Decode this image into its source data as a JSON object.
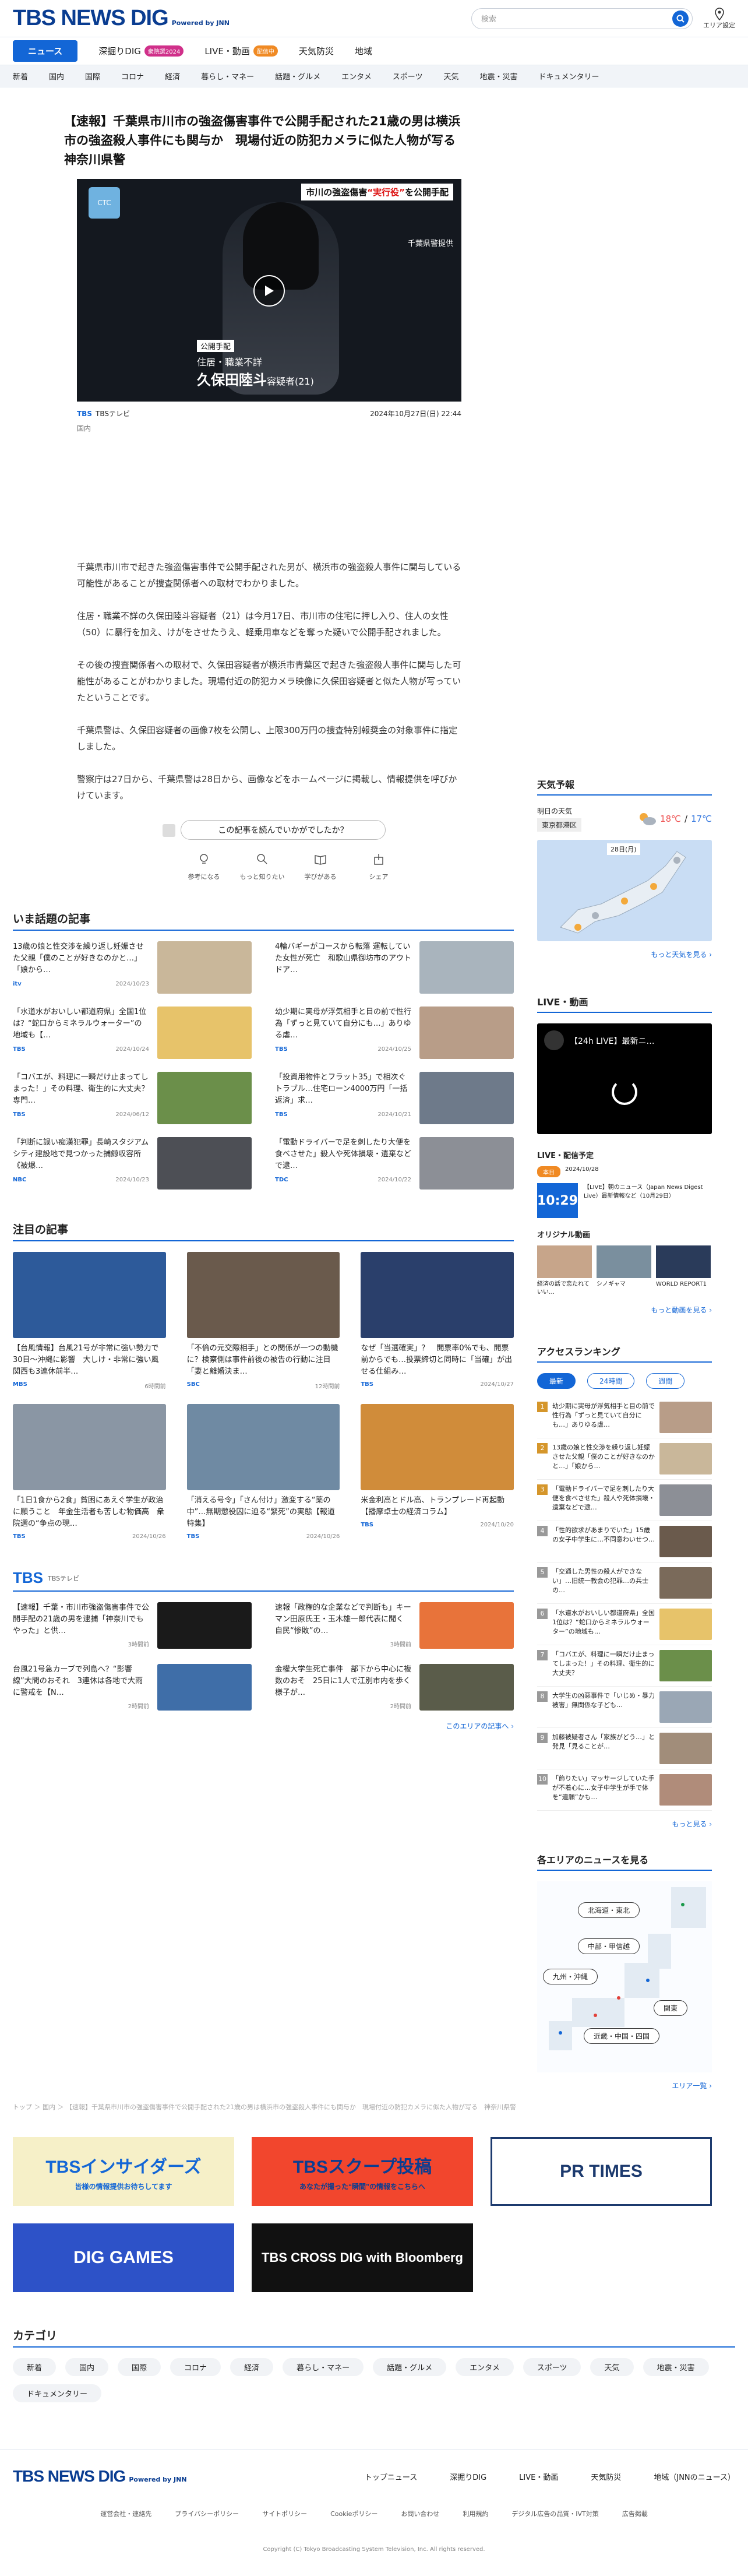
{
  "header": {
    "logo": "TBS NEWS DIG",
    "powered": "Powered by JNN",
    "search_placeholder": "検索",
    "area_label": "エリア設定"
  },
  "nav_main": [
    {
      "label": "ニュース",
      "active": true
    },
    {
      "label": "深掘りDIG",
      "badge": "衆院選2024"
    },
    {
      "label": "LIVE・動画",
      "badge": "配信中"
    },
    {
      "label": "天気防災"
    },
    {
      "label": "地域"
    }
  ],
  "nav_cats": [
    "新着",
    "国内",
    "国際",
    "コロナ",
    "経済",
    "暮らし・マネー",
    "話題・グルメ",
    "エンタメ",
    "スポーツ",
    "天気",
    "地震・災害",
    "ドキュメンタリー"
  ],
  "article": {
    "title": "【速報】千葉県市川市の強盗傷害事件で公開手配された21歳の男は横浜市の強盗殺人事件にも関与か　現場付近の防犯カメラに似た人物が写る　神奈川県警",
    "hero": {
      "caption_pre": "市川の強盗傷害",
      "caption_mid": "“実行役”",
      "caption_post": "を公開手配",
      "credit": "千葉県警提供",
      "tag": "公開手配",
      "line1": "住居・職業不詳",
      "name": "久保田陸斗",
      "suffix": "容疑者(21)"
    },
    "source": "TBSテレビ",
    "date": "2024年10月27日(日) 22:44",
    "category": "国内",
    "paragraphs": [
      "千葉県市川市で起きた強盗傷害事件で公開手配された男が、横浜市の強盗殺人事件に関与している可能性があることが捜査関係者への取材でわかりました。",
      "住居・職業不詳の久保田陸斗容疑者（21）は今月17日、市川市の住宅に押し入り、住人の女性（50）に暴行を加え、けがをさせたうえ、軽乗用車などを奪った疑いで公開手配されました。",
      "その後の捜査関係者への取材で、久保田容疑者が横浜市青葉区で起きた強盗殺人事件に関与した可能性があることがわかりました。現場付近の防犯カメラ映像に久保田容疑者と似た人物が写っていたということです。",
      "千葉県警は、久保田容疑者の画像7枚を公開し、上限300万円の捜査特別報奨金の対象事件に指定しました。",
      "警察庁は27日から、千葉県警は28日から、画像などをホームページに掲載し、情報提供を呼びかけています。"
    ],
    "feedback_question": "この記事を読んでいかがでしたか？",
    "feedback_options": [
      "参考になる",
      "もっと知りたい",
      "学びがある",
      "シェア"
    ]
  },
  "trending": {
    "title": "いま話題の記事",
    "items": [
      {
        "title": "13歳の娘と性交渉を繰り返し妊娠させた父親「僕のことが好きなのかと…」「娘から…",
        "source": "itv",
        "date": "2024/10/23",
        "color": "#c9b79a"
      },
      {
        "title": "4輪バギーがコースから転落 運転していた女性が死亡　和歌山県御坊市のアウトドア…",
        "source": "",
        "date": "",
        "color": "#a9b4bd"
      },
      {
        "title": "「水道水がおいしい都道府県」全国1位は？“蛇口からミネラルウォーター”の地域も【…",
        "source": "TBS",
        "date": "2024/10/24",
        "color": "#e7c36a"
      },
      {
        "title": "幼少期に実母が浮気相手と目の前で性行為「ずっと見ていて自分にも…」ありゆる虐…",
        "source": "TBS",
        "date": "2024/10/25",
        "color": "#b89d88"
      },
      {
        "title": "「コバエが、料理に一瞬だけ止まってしまった！」その料理、衛生的に大丈夫？専門…",
        "source": "TBS",
        "date": "2024/06/12",
        "color": "#6b8f4a"
      },
      {
        "title": "「投資用物件とフラット35」で相次ぐトラブル…住宅ローン4000万円「一括返済」求…",
        "source": "TBS",
        "date": "2024/10/21",
        "color": "#6e7a8a"
      },
      {
        "title": "「判断に誤い痴漢犯罪」長崎スタジアムシティ建設地で見つかった捕鯨収容所《被爆…",
        "source": "NBC",
        "date": "2024/10/23",
        "color": "#4d4f55"
      },
      {
        "title": "「電動ドライバーで足を刺したり大便を食べさせた」殺人や死体損壊・遺棄などで逮…",
        "source": "TDC",
        "date": "2024/10/22",
        "color": "#8c8f96"
      }
    ]
  },
  "featured": {
    "title": "注目の記事",
    "items": [
      {
        "title": "【台風情報】台風21号が非常に強い勢力で30日〜沖縄に影響　大しけ・非常に強い風　関西も3連休前半…",
        "source": "MBS",
        "date": "6時間前",
        "color": "#2d5a9a"
      },
      {
        "title": "「不倫の元交際相手」との関係が一つの動機に？検察側は事件前後の被告の行動に注目「妻と離婚決ま…",
        "source": "SBC",
        "date": "12時間前",
        "color": "#6a5a4c"
      },
      {
        "title": "なぜ「当選確実」？　開票率0%でも、開票前からでも…投票締切と同時に「当確」が出せる仕組み…",
        "source": "TBS",
        "date": "2024/10/27",
        "color": "#2a3f6b"
      },
      {
        "title": "「1日1食から2食」貧困にあえぐ学生が政治に願うこと　年金生活者も苦しむ物価高　衆院選の“争点の現…",
        "source": "TBS",
        "date": "2024/10/26",
        "color": "#8a96a4"
      },
      {
        "title": "「消える号令」「さん付け」激変する“薬の中”…無期懲役囚に迫る“緊死”の実態【報道特集】",
        "source": "TBS",
        "date": "2024/10/26",
        "color": "#6f8aa3"
      },
      {
        "title": "米金利高とドル高、トランプレード再起動【播摩卓士の経済コラム】",
        "source": "TBS",
        "date": "2024/10/20",
        "color": "#d08c3a"
      }
    ]
  },
  "tbs_section": {
    "logo": "TBS",
    "sub": "TBSテレビ",
    "items": [
      {
        "title": "【速報】千葉・市川市強盗傷害事件で公開手配の21歳の男を逮捕「神奈川でもやった」と供…",
        "date": "3時間前",
        "color": "#1a1a1a"
      },
      {
        "title": "速報「政権的な企業などで判断も」キーマン田原氏王・玉木雄一郎代表に聞く 自民“惨敗”の…",
        "date": "3時間前",
        "color": "#e8733a"
      },
      {
        "title": "台風21号急カーブで列島へ？“影響線”大間のおそれ　3連休は各地で大雨に警戒を【N…",
        "date": "2時間前",
        "color": "#3f6ea8"
      },
      {
        "title": "金權大学生死亡事件　部下から中心に複数のおそ　25日に1人で江別市内を歩く様子が…",
        "date": "2時間前",
        "color": "#5a5c4a"
      }
    ],
    "more": "このエリアの記事へ ›"
  },
  "breadcrumb": "トップ ＞ 国内 ＞ 【速報】千葉県市川市の強盗傷害事件で公開手配された21歳の男は横浜市の強盗殺人事件にも関与か　現場付近の防犯カメラに似た人物が写る　神奈川県警",
  "banners": [
    {
      "label": "TBSインサイダーズ",
      "sub": "皆様の情報提供お待ちしてます",
      "bg": "#f6f0c8",
      "fg": "#1366d6"
    },
    {
      "label": "TBSスクープ投稿",
      "sub": "あなたが撮った“瞬間”の情報をこちらへ",
      "bg": "#f2462d",
      "fg": "#0a3d91"
    },
    {
      "label": "PR TIMES",
      "sub": "",
      "bg": "#ffffff",
      "fg": "#1c3a6e"
    },
    {
      "label": "DIG GAMES",
      "sub": "",
      "bg": "#2d52c8",
      "fg": "#ffffff"
    },
    {
      "label": "TBS CROSS DIG with Bloomberg",
      "sub": "",
      "bg": "#111111",
      "fg": "#ffffff"
    }
  ],
  "categories_title": "カテゴリ",
  "category_chips": [
    "新着",
    "国内",
    "国際",
    "コロナ",
    "経済",
    "暮らし・マネー",
    "話題・グルメ",
    "エンタメ",
    "スポーツ",
    "天気",
    "地震・災害",
    "ドキュメンタリー"
  ],
  "footer": {
    "links": [
      "トップニュース",
      "深掘りDIG",
      "LIVE・動画",
      "天気防災",
      "地域（JNNのニュース）"
    ],
    "sub": [
      "運営会社・連絡先",
      "プライバシーポリシー",
      "サイトポリシー",
      "Cookieポリシー",
      "お問い合わせ",
      "利用規約",
      "デジタル広告の品質・IVT対策",
      "広告掲載"
    ],
    "copyright": "Copyright (C) Tokyo Broadcasting System Television, Inc. All rights reserved."
  },
  "side": {
    "weather_title": "天気予報",
    "weather_day": "明日の天気",
    "weather_city": "東京都港区",
    "temp_high": "18℃",
    "temp_low": "17℃",
    "map_date": "28日(月)",
    "weather_more": "もっと天気を見る ›",
    "live_title": "LIVE・動画",
    "live_video": "【24h LIVE】最新ニ…",
    "sched_title": "LIVE・配信予定",
    "sched_label": "本日",
    "sched_date": "2024/10/28",
    "sched_time": "10:29",
    "sched_text": "【LIVE】朝のニュース（Japan News Digest Live）最新情報など（10月29日）",
    "orig_title": "オリジナル動画",
    "orig_items": [
      "経済の話で恋たれていい…",
      "シノギャマ",
      "WORLD REPORT1"
    ],
    "orig_more": "もっと動画を見る ›",
    "rank_title": "アクセスランキング",
    "rank_tabs": [
      "最新",
      "24時間",
      "週間"
    ],
    "rank_items": [
      "幼少期に実母が浮気相手と目の前で性行為「ずっと見ていて自分にも…」ありゆる虐…",
      "13歳の娘と性交渉を繰り返し妊娠させた父親「僕のことが好きなのかと…」「娘から…",
      "「電動ドライバーで足を刺したり大便を食べさせた」殺人や死体損壊・遺棄などで逮…",
      "「性的欲求があまりでいた」15歳の女子中学生に…不同意わいせつ…",
      "「交通した男性の殺人ができない」…旧統一教会の犯罪…の兵士の…",
      "「水道水がおいしい都道府県」全国1位は？“蛇口からミネラルウォーター”の地域も…",
      "「コバエが、料理に一瞬だけ止まってしまった！」その料理、衛生的に大丈夫？",
      "大学生の凶悪事件で「いじめ・暴力被害」無関係な子ども…",
      "加藤被疑者さん「家族がどう…」と発見「見ることが…",
      "「飾りたい」マッサージしていた手が不着心に…女子中学生が手で体を“遺願”かも…"
    ],
    "rank_more": "もっと見る ›",
    "area_title": "各エリアのニュースを見る",
    "area_buttons": [
      "北海道・東北",
      "中部・甲信越",
      "九州・沖縄",
      "関東",
      "近畿・中国・四国"
    ],
    "area_more": "エリア一覧 ›"
  }
}
